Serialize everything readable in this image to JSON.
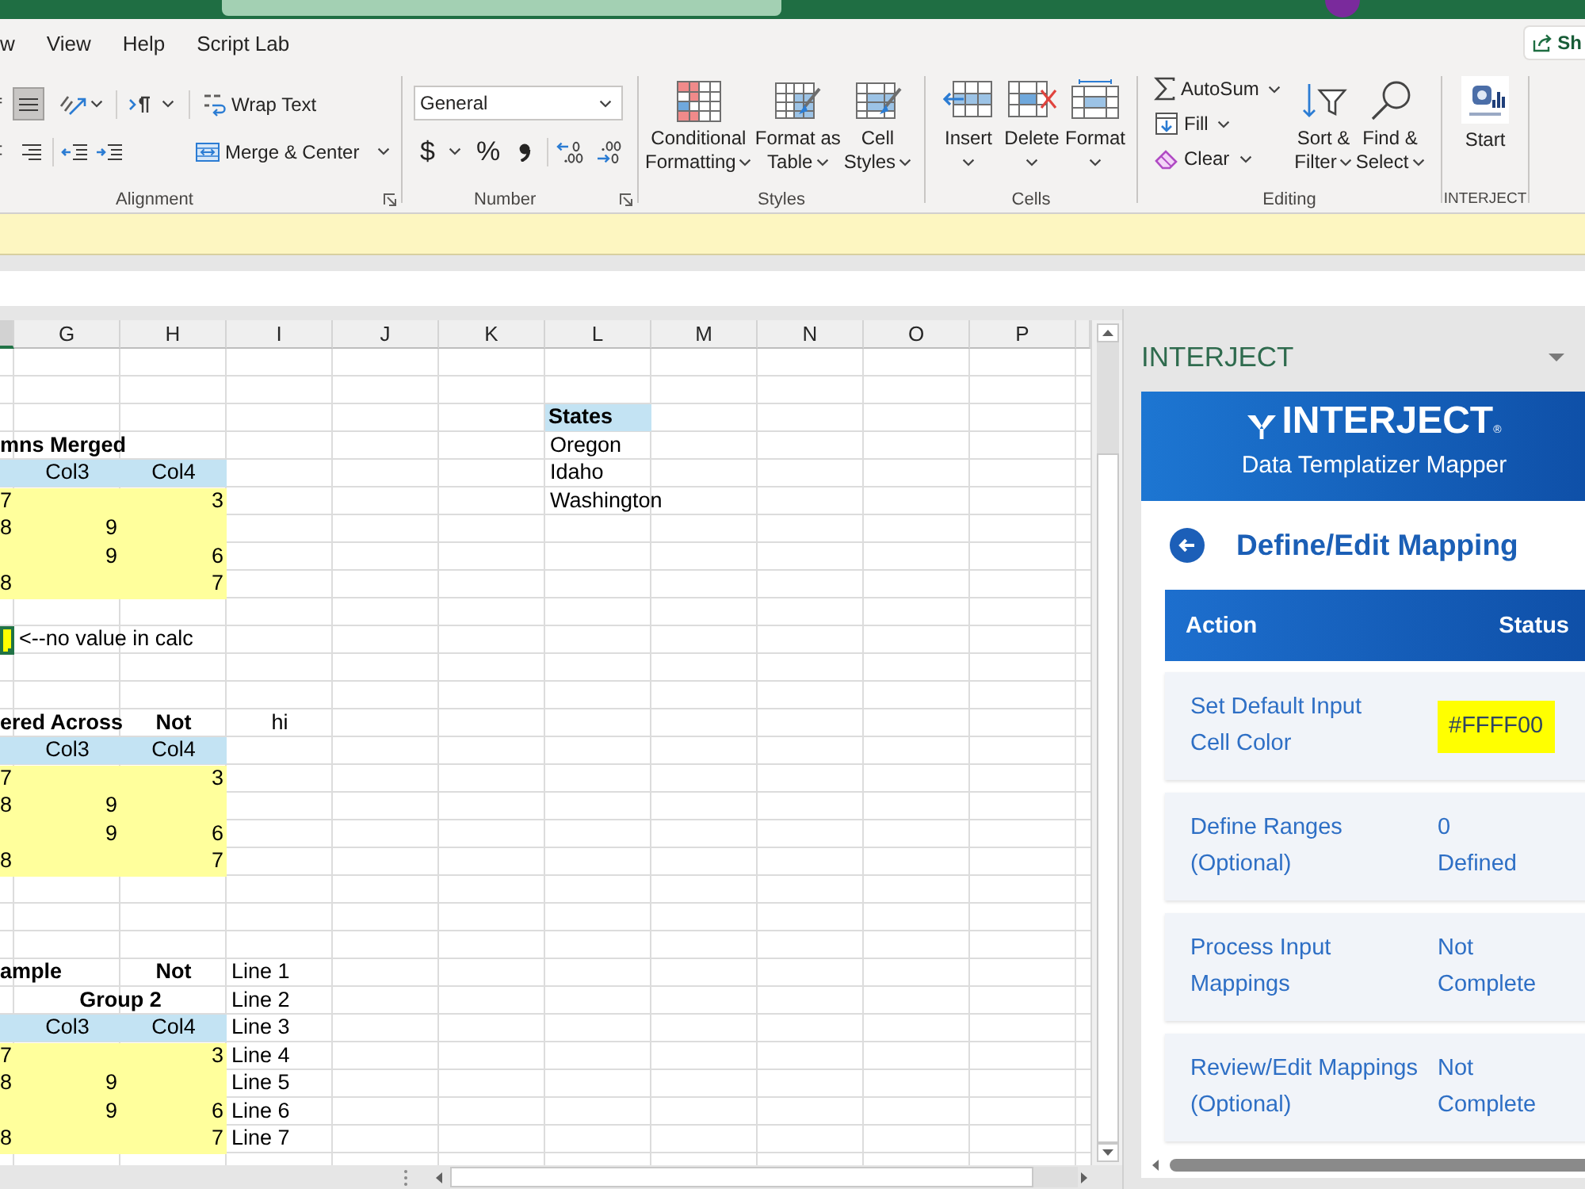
{
  "ribbon_tabs": [
    {
      "label": "w",
      "selected": false
    },
    {
      "label": "View",
      "selected": false
    },
    {
      "label": "Help",
      "selected": false
    },
    {
      "label": "Script Lab",
      "selected": false
    }
  ],
  "share_button": {
    "label": "Sh"
  },
  "ribbon": {
    "alignment": {
      "vertical_align": [
        {
          "selected": false
        },
        {
          "selected": true
        }
      ],
      "wrap_text": "Wrap Text",
      "horizontal_align": [
        {
          "selected": false
        },
        {
          "selected": false
        }
      ],
      "merge": "Merge & Center",
      "label": "Alignment"
    },
    "number": {
      "format": "General",
      "currency": "$",
      "percent": "%",
      "label": "Number"
    },
    "styles": {
      "buttons": [
        {
          "lines": [
            "Conditional",
            "Formatting"
          ]
        },
        {
          "lines": [
            "Format as",
            "Table"
          ]
        },
        {
          "lines": [
            "Cell",
            "Styles"
          ]
        }
      ],
      "label": "Styles"
    },
    "cells": {
      "buttons": [
        {
          "label": "Insert"
        },
        {
          "label": "Delete"
        },
        {
          "label": "Format"
        }
      ],
      "label": "Cells"
    },
    "editing": {
      "small_buttons": [
        {
          "label": "AutoSum"
        },
        {
          "label": "Fill"
        },
        {
          "label": "Clear"
        }
      ],
      "buttons": [
        {
          "lines": [
            "Sort &",
            "Filter"
          ]
        },
        {
          "lines": [
            "Find &",
            "Select"
          ]
        }
      ],
      "label": "Editing"
    },
    "add_in": {
      "button": "Start",
      "label": "INTERJECT"
    }
  },
  "sheet": {
    "columns": [
      {
        "selected": true
      },
      {
        "label": "G",
        "selected": false
      },
      {
        "label": "H",
        "selected": false
      },
      {
        "label": "I",
        "selected": false
      },
      {
        "label": "J",
        "selected": false
      },
      {
        "label": "K",
        "selected": false
      },
      {
        "label": "L",
        "selected": false
      },
      {
        "label": "M",
        "selected": false
      },
      {
        "label": "N",
        "selected": false
      },
      {
        "label": "O",
        "selected": false
      },
      {
        "label": "P",
        "selected": false
      },
      {
        "selected": false
      }
    ],
    "rows": [
      null,
      null,
      [
        null,
        null,
        null,
        null,
        null,
        null,
        {
          "kind": "list-header",
          "text": "States",
          "selected": false
        }
      ],
      [
        {
          "kind": "title",
          "text": "mns Merged",
          "selected": false
        },
        null,
        null,
        null,
        null,
        null,
        {
          "kind": "text",
          "text": "Oregon",
          "selected": false
        }
      ],
      [
        {
          "kind": "header",
          "selected": false
        },
        {
          "kind": "header",
          "text": "Col3",
          "selected": false
        },
        {
          "kind": "header",
          "text": "Col4",
          "selected": false
        },
        null,
        null,
        null,
        {
          "kind": "text",
          "text": "Idaho",
          "selected": false
        }
      ],
      [
        {
          "kind": "input",
          "text": "7",
          "selected": false
        },
        {
          "kind": "input",
          "selected": false
        },
        {
          "kind": "input",
          "text": "3",
          "selected": false
        },
        null,
        null,
        null,
        {
          "kind": "text",
          "text": "Washington",
          "selected": false
        }
      ],
      [
        {
          "kind": "input",
          "text": "8",
          "selected": false
        },
        {
          "kind": "input",
          "text": "9",
          "selected": false
        },
        {
          "kind": "input",
          "selected": false
        }
      ],
      [
        {
          "kind": "input",
          "selected": false
        },
        {
          "kind": "input",
          "text": "9",
          "selected": false
        },
        {
          "kind": "input",
          "text": "6",
          "selected": false
        }
      ],
      [
        {
          "kind": "input",
          "text": "8",
          "selected": false
        },
        {
          "kind": "input",
          "selected": false
        },
        {
          "kind": "input",
          "text": "7",
          "selected": false
        }
      ],
      null,
      [
        {
          "kind": "highlight",
          "selected": true
        },
        {
          "kind": "text",
          "text": "<--no value in calc",
          "selected": false
        }
      ],
      null,
      null,
      [
        {
          "kind": "title",
          "text": "ered Across",
          "selected": false
        },
        null,
        {
          "kind": "label",
          "text": "Not",
          "selected": false
        },
        {
          "kind": "centered",
          "text": "hi",
          "selected": false
        }
      ],
      [
        {
          "kind": "header",
          "selected": false
        },
        {
          "kind": "header",
          "text": "Col3",
          "selected": false
        },
        {
          "kind": "header",
          "text": "Col4",
          "selected": false
        }
      ],
      [
        {
          "kind": "input",
          "text": "7",
          "selected": false
        },
        {
          "kind": "input",
          "selected": false
        },
        {
          "kind": "input",
          "text": "3",
          "selected": false
        }
      ],
      [
        {
          "kind": "input",
          "text": "8",
          "selected": false
        },
        {
          "kind": "input",
          "text": "9",
          "selected": false
        },
        {
          "kind": "input",
          "selected": false
        }
      ],
      [
        {
          "kind": "input",
          "selected": false
        },
        {
          "kind": "input",
          "text": "9",
          "selected": false
        },
        {
          "kind": "input",
          "text": "6",
          "selected": false
        }
      ],
      [
        {
          "kind": "input",
          "text": "8",
          "selected": false
        },
        {
          "kind": "input",
          "selected": false
        },
        {
          "kind": "input",
          "text": "7",
          "selected": false
        }
      ],
      null,
      null,
      null,
      [
        {
          "kind": "title",
          "text": "ample",
          "selected": false
        },
        null,
        {
          "kind": "label",
          "text": "Not",
          "selected": false
        },
        {
          "kind": "text",
          "text": "Line 1",
          "selected": false
        }
      ],
      [
        null,
        {
          "kind": "group",
          "text": "Group 2",
          "selected": false
        },
        {
          "kind": "text",
          "text": "Line 2",
          "selected": false
        }
      ],
      [
        {
          "kind": "header",
          "selected": false
        },
        {
          "kind": "header",
          "text": "Col3",
          "selected": false
        },
        {
          "kind": "header",
          "text": "Col4",
          "selected": false
        },
        {
          "kind": "text",
          "text": "Line 3",
          "selected": false
        }
      ],
      [
        {
          "kind": "input",
          "text": "7",
          "selected": false
        },
        {
          "kind": "input",
          "selected": false
        },
        {
          "kind": "input",
          "text": "3",
          "selected": false
        },
        {
          "kind": "text",
          "text": "Line 4",
          "selected": false
        }
      ],
      [
        {
          "kind": "input",
          "text": "8",
          "selected": false
        },
        {
          "kind": "input",
          "text": "9",
          "selected": false
        },
        {
          "kind": "input",
          "selected": false
        },
        {
          "kind": "text",
          "text": "Line 5",
          "selected": false
        }
      ],
      [
        {
          "kind": "input",
          "selected": false
        },
        {
          "kind": "input",
          "text": "9",
          "selected": false
        },
        {
          "kind": "input",
          "text": "6",
          "selected": false
        },
        {
          "kind": "text",
          "text": "Line 6",
          "selected": false
        }
      ],
      [
        {
          "kind": "input",
          "text": "8",
          "selected": false
        },
        {
          "kind": "input",
          "selected": false
        },
        {
          "kind": "input",
          "text": "7",
          "selected": false
        },
        {
          "kind": "text",
          "text": "Line 7",
          "selected": false
        }
      ],
      null
    ]
  },
  "task_pane": {
    "title": "INTERJECT",
    "brand": "INTERJECT$_{®}$",
    "subtitle": "Data Templatizer Mapper",
    "heading": "Define/Edit Mapping",
    "columns": [
      "Action",
      "Status"
    ],
    "steps": [
      {
        "action": [
          "Set Default Input",
          "Cell Color"
        ],
        "kind": "swatch",
        "color": "#ffff00",
        "status": [
          "#FFFF00"
        ]
      },
      {
        "action": [
          "Define Ranges",
          "(Optional)"
        ],
        "kind": "text",
        "status": [
          "0",
          "Defined"
        ]
      },
      {
        "action": [
          "Process Input",
          "Mappings"
        ],
        "kind": "text",
        "status": [
          "Not",
          "Complete"
        ]
      },
      {
        "action": [
          "Review/Edit Mappings",
          "(Optional)"
        ],
        "kind": "text",
        "status": [
          "Not",
          "Complete"
        ]
      }
    ]
  }
}
